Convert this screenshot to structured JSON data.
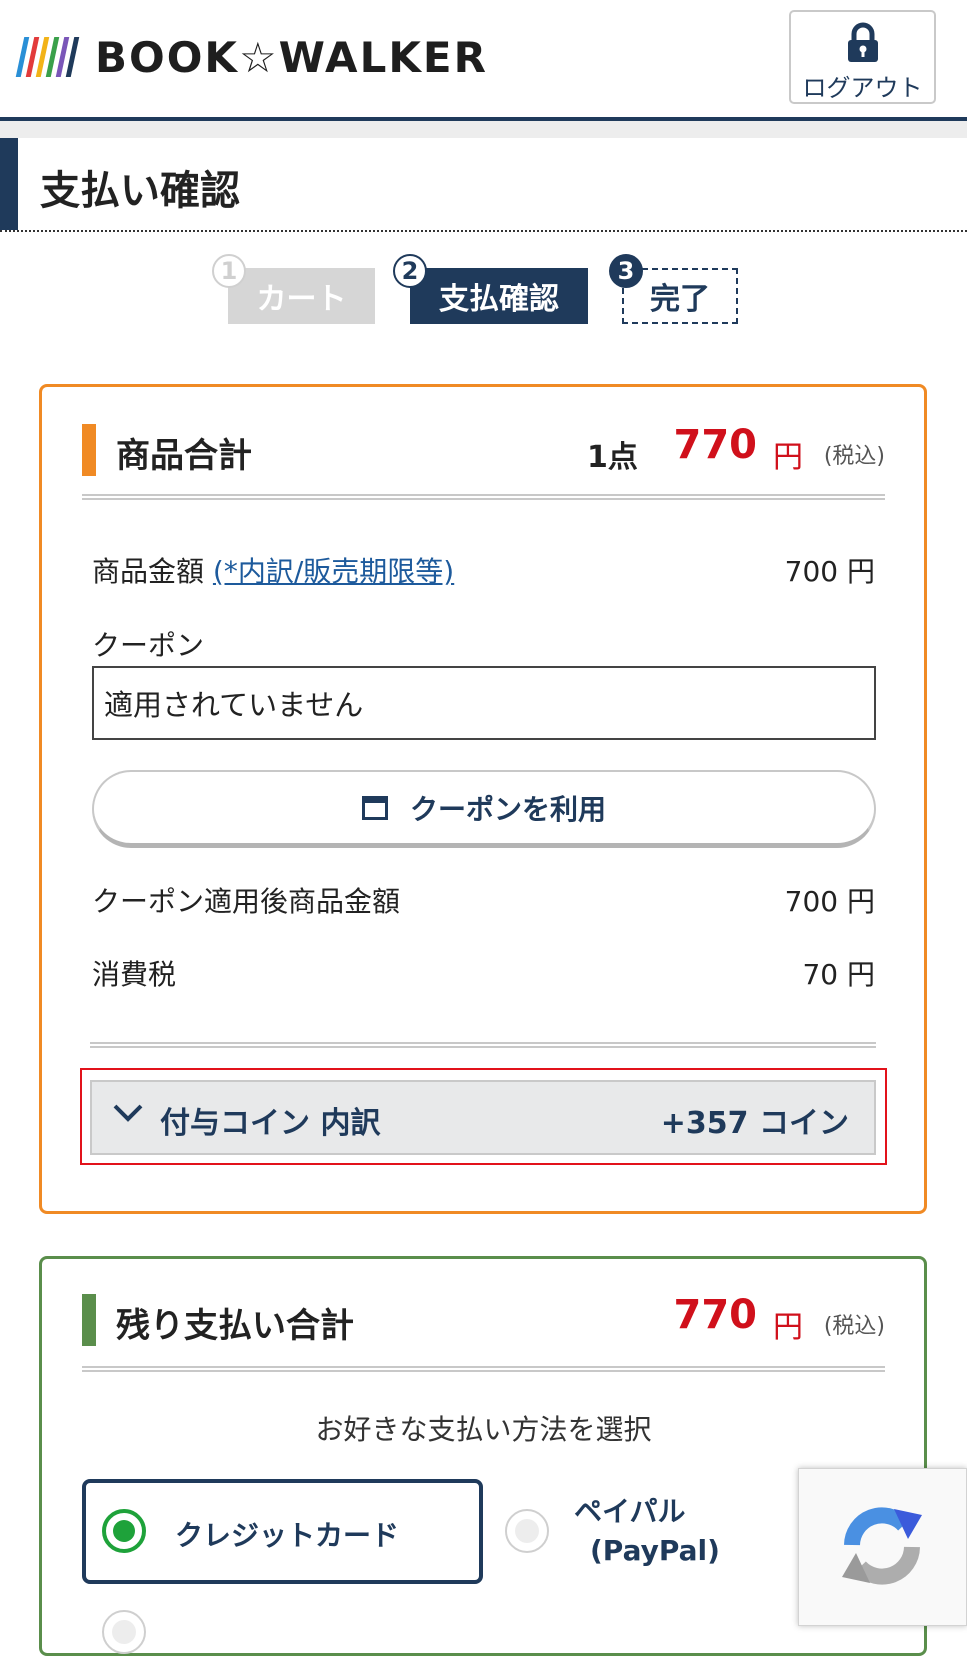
{
  "header": {
    "brand": "BOOK☆WALKER",
    "logout_label": "ログアウト",
    "stripe_colors": [
      "#2a8fd6",
      "#e23b3b",
      "#f2b318",
      "#3aa04a",
      "#7a56b8",
      "#1f3a5b"
    ]
  },
  "page": {
    "title": "支払い確認"
  },
  "steps": [
    {
      "num": "1",
      "label": "カート",
      "state": "done"
    },
    {
      "num": "2",
      "label": "支払確認",
      "state": "current"
    },
    {
      "num": "3",
      "label": "完了",
      "state": "upcoming"
    }
  ],
  "summary": {
    "title": "商品合計",
    "count": "1点",
    "total": "770",
    "currency": "円",
    "tax_note": "(税込)",
    "item_price_label": "商品金額",
    "item_price_link": "(*内訳/販売期限等)",
    "item_price_value": "700 円",
    "coupon_label": "クーポン",
    "coupon_field_value": "適用されていません",
    "coupon_button": "クーポンを利用",
    "after_coupon_label": "クーポン適用後商品金額",
    "after_coupon_value": "700 円",
    "tax_label": "消費税",
    "tax_value": "70 円",
    "coin_label": "付与コイン 内訳",
    "coin_value": "+357 コイン"
  },
  "remaining": {
    "title": "残り支払い合計",
    "total": "770",
    "currency": "円",
    "tax_note": "(税込)",
    "select_prompt": "お好きな支払い方法を選択",
    "methods": [
      {
        "label": "クレジットカード",
        "selected": true
      },
      {
        "label_line1": "ペイパル",
        "label_line2": "(PayPal)",
        "selected": false
      }
    ]
  },
  "colors": {
    "navy": "#1f3a5b",
    "price_red": "#d0101b",
    "orange_border": "#f08a24",
    "green_border": "#5a8e4b",
    "highlight_red": "#e2121b",
    "radio_green": "#1ea23a"
  },
  "icons": {
    "lock": "lock-icon",
    "calendar": "calendar-icon",
    "chevron": "chevron-down-icon",
    "recaptcha": "recaptcha-icon"
  }
}
